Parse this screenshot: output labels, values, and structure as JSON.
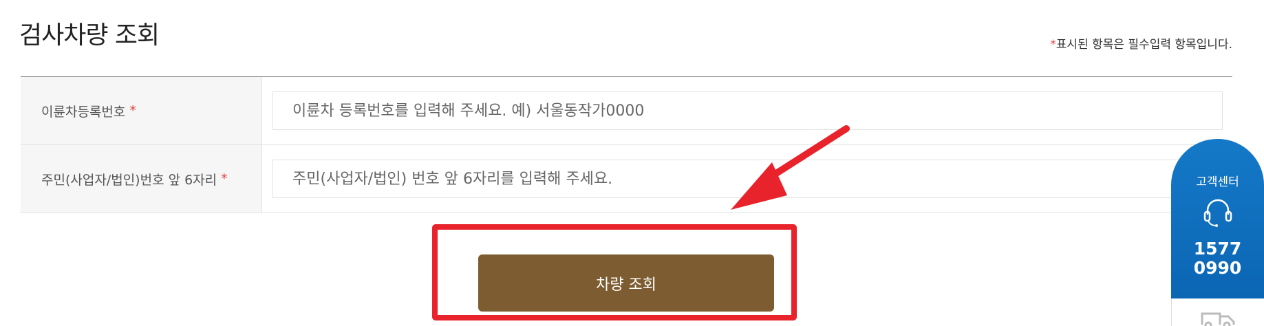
{
  "page": {
    "title": "검사차량 조회",
    "required_star": "*",
    "required_note": "표시된 항목은 필수입력 항목입니다."
  },
  "form": {
    "rows": [
      {
        "label": "이륜차등록번호",
        "required": "*",
        "placeholder": "이륜차 등록번호를 입력해 주세요. 예) 서울동작가0000"
      },
      {
        "label": "주민(사업자/법인)번호 앞 6자리",
        "required": "*",
        "placeholder": "주민(사업자/법인) 번호 앞 6자리를 입력해 주세요."
      }
    ],
    "submit_label": "차량 조회"
  },
  "colors": {
    "button_brown": "#7d5c31",
    "highlight_red": "#e8232c",
    "required_red": "#e03a3a",
    "widget_blue": "#0b66b4"
  },
  "side_widget": {
    "label": "고객센터",
    "icon": "headset-icon",
    "phone_line1": "1577",
    "phone_line2": "0990",
    "secondary_icon": "truck-icon"
  }
}
